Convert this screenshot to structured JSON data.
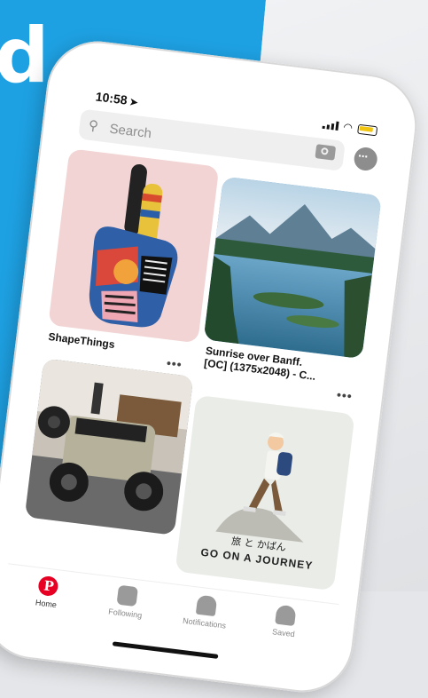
{
  "background": {
    "brand_letter": "d",
    "left_color": "#1ea1e3"
  },
  "status_bar": {
    "time": "10:58",
    "location_glyph": "➤"
  },
  "search": {
    "placeholder": "Search",
    "icon": "search-icon",
    "camera_icon": "camera-icon"
  },
  "header": {
    "messages_icon": "chat-bubble-icon"
  },
  "pins": [
    {
      "title": "ShapeThings",
      "more": "•••"
    },
    {
      "title": "Sunrise over Banff.\n[OC] (1375x2048) - C...",
      "more": "•••"
    },
    {
      "title": "",
      "more": ""
    },
    {
      "title": "",
      "caption_jp": "旅 と かばん",
      "caption": "GO ON A JOURNEY"
    }
  ],
  "tabs": [
    {
      "label": "Home",
      "icon": "pinterest-logo-icon",
      "active": true
    },
    {
      "label": "Following",
      "icon": "people-icon",
      "active": false
    },
    {
      "label": "Notifications",
      "icon": "bell-icon",
      "active": false
    },
    {
      "label": "Saved",
      "icon": "person-icon",
      "active": false
    }
  ],
  "colors": {
    "brand_red": "#e60023",
    "accent_blue": "#1ea1e3"
  }
}
